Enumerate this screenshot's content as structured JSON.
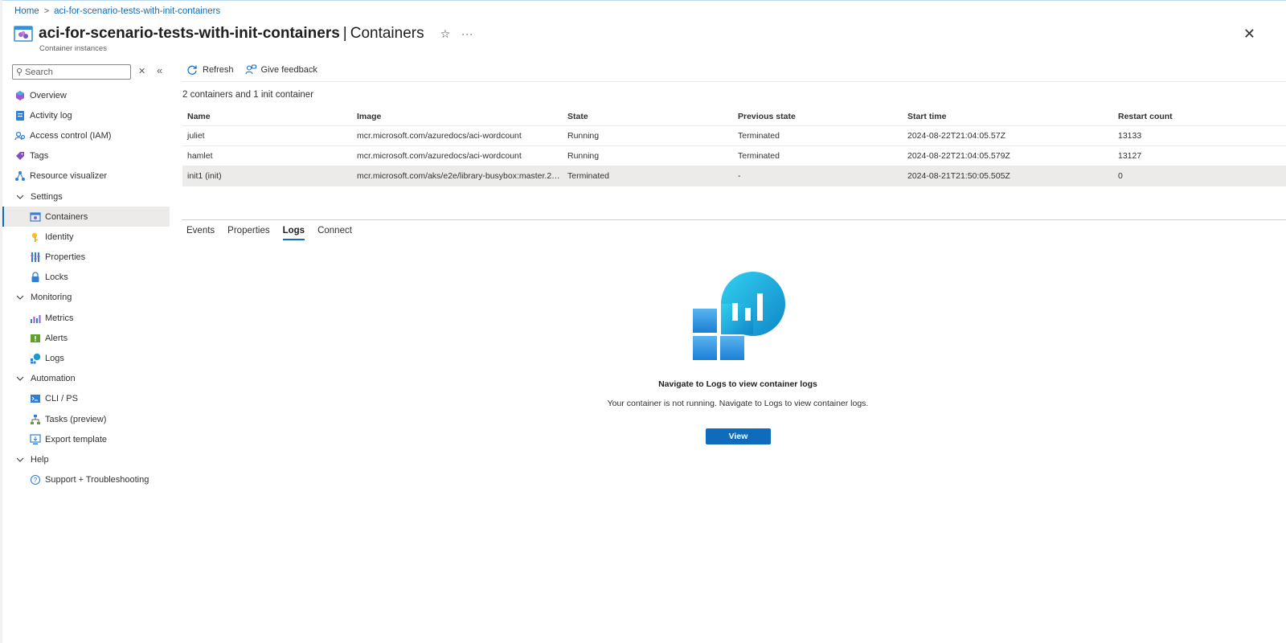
{
  "breadcrumb": {
    "home": "Home",
    "resource": "aci-for-scenario-tests-with-init-containers",
    "separator": ">"
  },
  "header": {
    "resource_name": "aci-for-scenario-tests-with-init-containers",
    "separator": "|",
    "blade": "Containers",
    "subtitle": "Container instances",
    "star": "☆",
    "more": "···",
    "close": "✕"
  },
  "sidebar": {
    "search_placeholder": "Search",
    "clear_icon": "✕",
    "collapse_icon": "«",
    "items": [
      {
        "label": "Overview",
        "icon": "overview-icon"
      },
      {
        "label": "Activity log",
        "icon": "activity-log-icon"
      },
      {
        "label": "Access control (IAM)",
        "icon": "iam-icon"
      },
      {
        "label": "Tags",
        "icon": "tag-icon"
      },
      {
        "label": "Resource visualizer",
        "icon": "resource-visualizer-icon"
      }
    ],
    "groups": [
      {
        "label": "Settings",
        "items": [
          {
            "label": "Containers",
            "icon": "containers-icon",
            "active": true
          },
          {
            "label": "Identity",
            "icon": "identity-icon"
          },
          {
            "label": "Properties",
            "icon": "properties-icon"
          },
          {
            "label": "Locks",
            "icon": "lock-icon"
          }
        ]
      },
      {
        "label": "Monitoring",
        "items": [
          {
            "label": "Metrics",
            "icon": "metrics-icon"
          },
          {
            "label": "Alerts",
            "icon": "alerts-icon"
          },
          {
            "label": "Logs",
            "icon": "logs-icon"
          }
        ]
      },
      {
        "label": "Automation",
        "items": [
          {
            "label": "CLI / PS",
            "icon": "cli-icon"
          },
          {
            "label": "Tasks (preview)",
            "icon": "tasks-icon"
          },
          {
            "label": "Export template",
            "icon": "export-template-icon"
          }
        ]
      },
      {
        "label": "Help",
        "items": [
          {
            "label": "Support + Troubleshooting",
            "icon": "help-icon"
          }
        ]
      }
    ]
  },
  "toolbar": {
    "refresh": "Refresh",
    "feedback": "Give feedback"
  },
  "summary": "2 containers and 1 init container",
  "table": {
    "headers": [
      "Name",
      "Image",
      "State",
      "Previous state",
      "Start time",
      "Restart count"
    ],
    "rows": [
      [
        "juliet",
        "mcr.microsoft.com/azuredocs/aci-wordcount",
        "Running",
        "Terminated",
        "2024-08-22T21:04:05.57Z",
        "13133"
      ],
      [
        "hamlet",
        "mcr.microsoft.com/azuredocs/aci-wordcount",
        "Running",
        "Terminated",
        "2024-08-22T21:04:05.579Z",
        "13127"
      ],
      [
        "init1 (init)",
        "mcr.microsoft.com/aks/e2e/library-busybox:master.21...",
        "Terminated",
        "-",
        "2024-08-21T21:50:05.505Z",
        "0"
      ]
    ],
    "selected_row": 2
  },
  "tabs": [
    {
      "label": "Events"
    },
    {
      "label": "Properties"
    },
    {
      "label": "Logs",
      "active": true
    },
    {
      "label": "Connect"
    }
  ],
  "empty_state": {
    "title": "Navigate to Logs to view container logs",
    "description": "Your container is not running. Navigate to Logs to view container logs.",
    "button": "View"
  },
  "colors": {
    "accent": "#0f6cbd",
    "selected_bg": "#edebe9"
  }
}
